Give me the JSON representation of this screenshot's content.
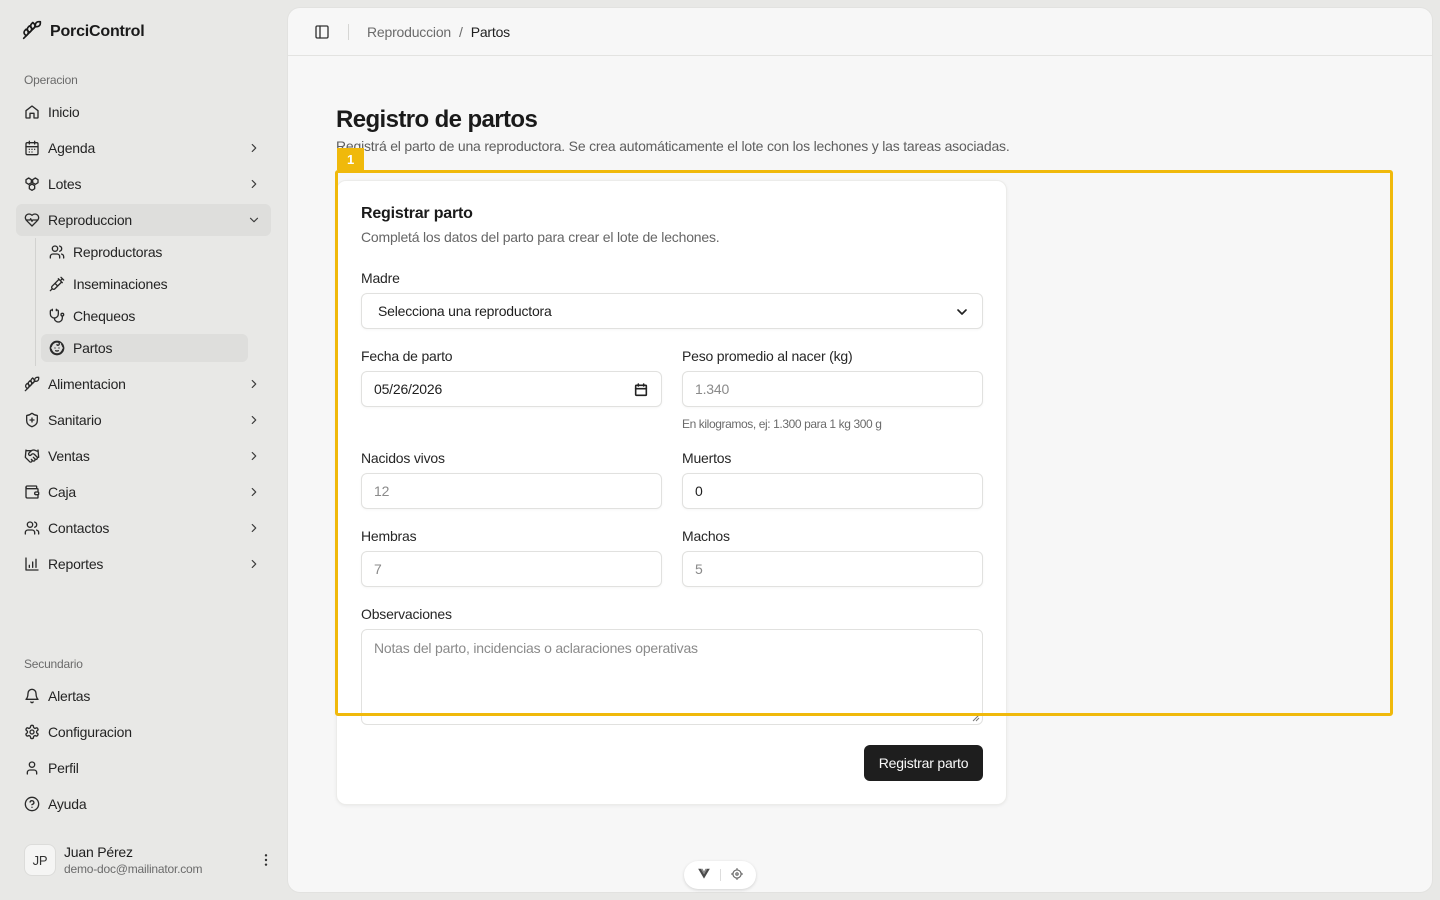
{
  "app": {
    "name": "PorciControl"
  },
  "sidebar": {
    "group_main": "Operacion",
    "group_secondary": "Secundario",
    "items": [
      {
        "label": "Inicio",
        "icon": "home-icon"
      },
      {
        "label": "Agenda",
        "icon": "calendar-icon"
      },
      {
        "label": "Lotes",
        "icon": "boxes-icon"
      },
      {
        "label": "Reproduccion",
        "icon": "heart-pulse-icon"
      },
      {
        "label": "Alimentacion",
        "icon": "wheat-icon"
      },
      {
        "label": "Sanitario",
        "icon": "shield-plus-icon"
      },
      {
        "label": "Ventas",
        "icon": "handshake-icon"
      },
      {
        "label": "Caja",
        "icon": "wallet-icon"
      },
      {
        "label": "Contactos",
        "icon": "users-icon"
      },
      {
        "label": "Reportes",
        "icon": "bar-chart-icon"
      }
    ],
    "sub_items": [
      {
        "label": "Reproductoras",
        "icon": "users-icon"
      },
      {
        "label": "Inseminaciones",
        "icon": "syringe-icon"
      },
      {
        "label": "Chequeos",
        "icon": "stethoscope-icon"
      },
      {
        "label": "Partos",
        "icon": "baby-icon"
      }
    ],
    "secondary_items": [
      {
        "label": "Alertas",
        "icon": "bell-icon"
      },
      {
        "label": "Configuracion",
        "icon": "settings-icon"
      },
      {
        "label": "Perfil",
        "icon": "user-icon"
      },
      {
        "label": "Ayuda",
        "icon": "help-circle-icon"
      }
    ],
    "user": {
      "initials": "JP",
      "name": "Juan Pérez",
      "email": "demo-doc@mailinator.com"
    }
  },
  "header": {
    "breadcrumb": [
      "Reproduccion",
      "Partos"
    ],
    "separator": "/"
  },
  "page": {
    "title": "Registro de partos",
    "subtitle": "Registrá el parto de una reproductora. Se crea automáticamente el lote con los lechones y las tareas asociadas."
  },
  "form": {
    "title": "Registrar parto",
    "subtitle": "Completá los datos del parto para crear el lote de lechones.",
    "madre_label": "Madre",
    "madre_value": "Selecciona una reproductora",
    "fecha_label": "Fecha de parto",
    "fecha_value": "05/26/2026",
    "peso_label": "Peso promedio al nacer (kg)",
    "peso_placeholder": "1.340",
    "peso_hint": "En kilogramos, ej: 1.300 para 1 kg 300 g",
    "vivos_label": "Nacidos vivos",
    "vivos_placeholder": "12",
    "muertos_label": "Muertos",
    "muertos_value": "0",
    "hembras_label": "Hembras",
    "hembras_placeholder": "7",
    "machos_label": "Machos",
    "machos_placeholder": "5",
    "obs_label": "Observaciones",
    "obs_placeholder": "Notas del parto, incidencias o aclaraciones operativas",
    "submit_label": "Registrar parto"
  },
  "highlight": {
    "tag": "1",
    "color": "#f0b90b"
  }
}
